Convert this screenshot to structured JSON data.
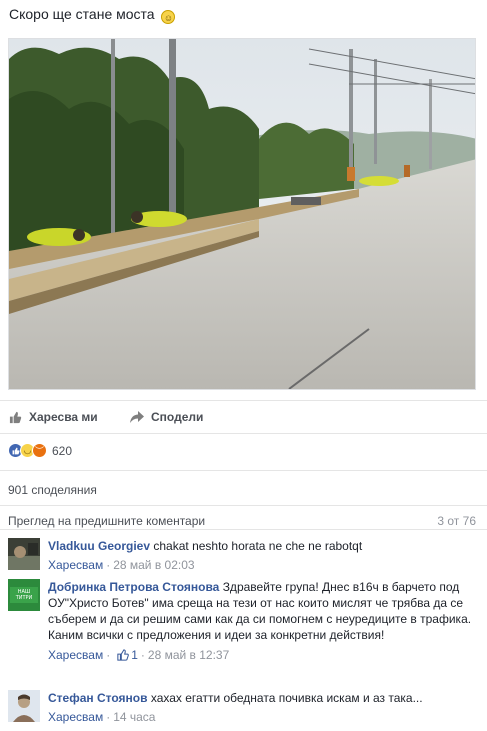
{
  "post": {
    "text": "Скоро ще стане моста",
    "emoji_icon": "smiley-emoji"
  },
  "actions": {
    "like_label": "Харесва ми",
    "share_label": "Сподели"
  },
  "reactions": {
    "types": [
      "like",
      "haha",
      "angry"
    ],
    "count": "620"
  },
  "shares": {
    "label": "901 споделяния"
  },
  "comments_header": {
    "prev_link": "Преглед на предишните коментари",
    "counter": "3 от 76"
  },
  "comments": [
    {
      "author": "Vladkuu Georgiev",
      "text": "chakat neshto horata ne che ne rabotqt",
      "like_label": "Харесвам",
      "likes": "",
      "time": "28 май в 02:03"
    },
    {
      "author": "Добринка Петрова Стоянова",
      "text": "Здравейте група! Днес в16ч в барчето под ОУ\"Христо Ботев\" има среща на тези от нас които мислят че трябва да се съберем и да си решим сами как да си помогнем с неуредиците в трафика. Каним всички с предложения и идеи за конкретни действия!",
      "like_label": "Харесвам",
      "likes": "1",
      "time": "28 май в 12:37"
    },
    {
      "author": "Стефан Стоянов",
      "text": "хахах егатти обедната почивка искам и аз така...",
      "like_label": "Харесвам",
      "likes": "",
      "time": "14 часа"
    }
  ],
  "colors": {
    "link": "#365899",
    "secondary_text": "#90949c",
    "like_blue": "#4267b2",
    "angry_orange": "#e9710f"
  }
}
